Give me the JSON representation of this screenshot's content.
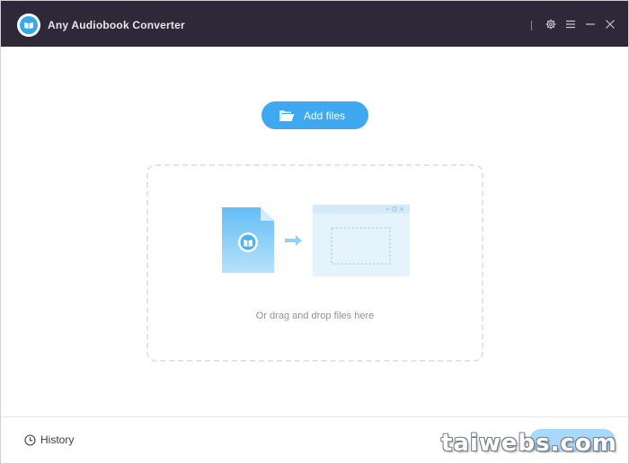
{
  "titlebar": {
    "app_title": "Any Audiobook Converter",
    "icons": [
      "settings-icon",
      "menu-icon",
      "minimize-icon",
      "close-icon"
    ]
  },
  "main": {
    "add_files_label": "Add files",
    "drop_hint": "Or drag and drop files here"
  },
  "footer": {
    "history_label": "History",
    "watermark": "taiwebs.com"
  },
  "colors": {
    "titlebar": "#2e2838",
    "accent": "#3ea9f1",
    "illustration_light": "#e5f3fc"
  }
}
